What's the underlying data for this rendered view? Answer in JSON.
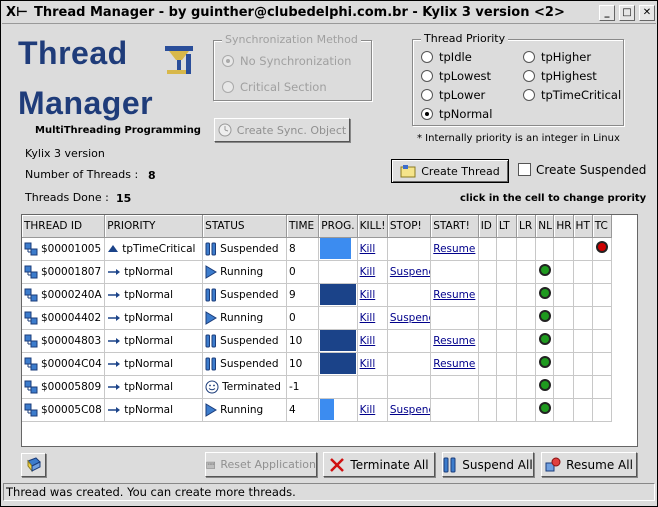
{
  "window": {
    "title": "Thread Manager - by guinther@clubedelphi.com.br - Kylix 3 version <2>",
    "minimize": "_",
    "maximize": "□",
    "close": "✕"
  },
  "header": {
    "app_line1": "Thread",
    "app_line2": "Manager",
    "subtitle": "MultiThreading Programming",
    "version": "Kylix 3 version",
    "threads_label": "Number of Threads :",
    "threads_value": "8",
    "done_label": "Threads Done :",
    "done_value": "15"
  },
  "sync": {
    "title": "Synchronization Method",
    "options": [
      "No Synchronization",
      "Critical Section"
    ],
    "selected": 0,
    "create_button": "Create Sync. Object"
  },
  "priority": {
    "title": "Thread Priority",
    "options": [
      "tpIdle",
      "tpLowest",
      "tpLower",
      "tpNormal",
      "tpHigher",
      "tpHighest",
      "tpTimeCritical"
    ],
    "selected": "tpNormal",
    "note": "* Internally priority is an integer in Linux"
  },
  "actions": {
    "create_thread": "Create Thread",
    "create_suspended": "Create Suspended",
    "hint": "click in the cell to change prority"
  },
  "grid": {
    "columns": [
      "THREAD ID",
      "PRIORITY",
      "STATUS",
      "TIME",
      "PROG.",
      "KILL!",
      "STOP!",
      "START!",
      "ID",
      "LT",
      "LR",
      "NL",
      "HR",
      "HT",
      "TC"
    ],
    "rows": [
      {
        "id": "$00001005",
        "priority": "tpTimeCritical",
        "status": "Suspended",
        "time": "8",
        "prog": 0.88,
        "kill": "Kill",
        "stop": "",
        "start": "Resume",
        "indicator": "TC",
        "indicator_color": "#cc0000"
      },
      {
        "id": "$00001807",
        "priority": "tpNormal",
        "status": "Running",
        "time": "0",
        "prog": 0,
        "kill": "Kill",
        "stop": "Suspend",
        "start": "",
        "indicator": "NL",
        "indicator_color": "#1f9a1f"
      },
      {
        "id": "$0000240A",
        "priority": "tpNormal",
        "status": "Suspended",
        "time": "9",
        "prog": 1.0,
        "kill": "Kill",
        "stop": "",
        "start": "Resume",
        "indicator": "NL",
        "indicator_color": "#1f9a1f"
      },
      {
        "id": "$00004402",
        "priority": "tpNormal",
        "status": "Running",
        "time": "0",
        "prog": 0,
        "kill": "Kill",
        "stop": "Suspend",
        "start": "",
        "indicator": "NL",
        "indicator_color": "#1f9a1f"
      },
      {
        "id": "$00004803",
        "priority": "tpNormal",
        "status": "Suspended",
        "time": "10",
        "prog": 1.0,
        "kill": "Kill",
        "stop": "",
        "start": "Resume",
        "indicator": "NL",
        "indicator_color": "#1f9a1f"
      },
      {
        "id": "$00004C04",
        "priority": "tpNormal",
        "status": "Suspended",
        "time": "10",
        "prog": 1.0,
        "kill": "Kill",
        "stop": "",
        "start": "Resume",
        "indicator": "NL",
        "indicator_color": "#1f9a1f"
      },
      {
        "id": "$00005809",
        "priority": "tpNormal",
        "status": "Terminated",
        "time": "-1",
        "prog": 0,
        "kill": "",
        "stop": "",
        "start": "",
        "indicator": "NL",
        "indicator_color": "#1f9a1f"
      },
      {
        "id": "$00005C08",
        "priority": "tpNormal",
        "status": "Running",
        "time": "4",
        "prog": 0.4,
        "kill": "Kill",
        "stop": "Suspend",
        "start": "",
        "indicator": "NL",
        "indicator_color": "#1f9a1f"
      }
    ]
  },
  "bottom": {
    "reset": "Reset Application",
    "terminate": "Terminate All",
    "suspend": "Suspend All",
    "resume": "Resume All"
  },
  "statusbar": "Thread was created. You can create more threads.",
  "colors": {
    "title_blue": "#1f3c7a",
    "progress": "#1b4389",
    "progress_light": "#3c8cf0",
    "link": "#00008b"
  }
}
